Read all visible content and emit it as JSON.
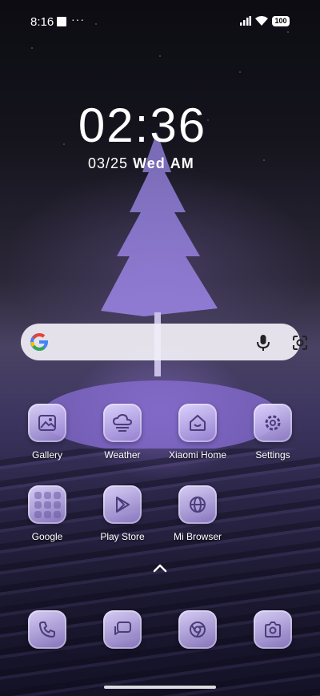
{
  "status_bar": {
    "time": "8:16",
    "more": "···",
    "battery": "100"
  },
  "clock": {
    "time": "02:36",
    "date": "03/25",
    "weekday": "Wed",
    "ampm": "AM"
  },
  "search": {
    "logo": "G"
  },
  "apps": [
    {
      "label": "Gallery",
      "icon": "gallery-icon"
    },
    {
      "label": "Weather",
      "icon": "weather-icon"
    },
    {
      "label": "Xiaomi Home",
      "icon": "xiaomi-home-icon"
    },
    {
      "label": "Settings",
      "icon": "gear-icon"
    },
    {
      "label": "Google",
      "icon": "folder-icon"
    },
    {
      "label": "Play Store",
      "icon": "play-store-icon"
    },
    {
      "label": "Mi Browser",
      "icon": "globe-icon"
    }
  ],
  "dock": [
    {
      "icon": "phone-icon"
    },
    {
      "icon": "messages-icon"
    },
    {
      "icon": "chrome-icon"
    },
    {
      "icon": "camera-icon"
    }
  ]
}
